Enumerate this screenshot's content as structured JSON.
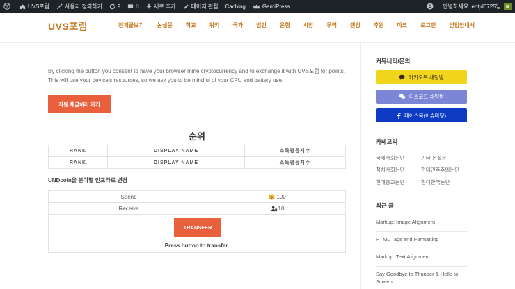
{
  "adminbar": {
    "site_name": "UVS포럼",
    "customize": "사용자 정의하기",
    "updates": "9",
    "comments": "0",
    "new": "새로 추가",
    "edit_page": "페이지 편집",
    "caching": "Caching",
    "gamipress": "GamiPress",
    "greeting": "안녕하세요. eotjd0725님"
  },
  "header": {
    "logo": "UVS포럼",
    "nav": [
      "전체글보기",
      "논설문",
      "학교",
      "위키",
      "국가",
      "법인",
      "은행",
      "시장",
      "무역",
      "랭킹",
      "후원",
      "마크",
      "로그인",
      "신입안내서"
    ]
  },
  "main": {
    "consent": "By clicking the button you consent to have your browser mine cryptocurrency and to exchange it with UVS포럼 for points. This will use your device's resources, so we ask you to be mindful of your CPU and battery use.",
    "mine_button": "자원 채굴하러 가기",
    "rank_title": "순위",
    "rank_headers": [
      [
        "RANK",
        "DISPLAY NAME",
        "소득평등지수"
      ],
      [
        "RANK",
        "DISPLAY NAME",
        "소득평등지수"
      ]
    ],
    "undcoin_title": "UNDcoin을 분야별 인프라로 변경",
    "spend_label": "Spend",
    "spend_value": "100",
    "receive_label": "Receive",
    "receive_value": "10",
    "transfer_button": "TRANSFER",
    "press_text": "Press button to transfer."
  },
  "sidebar": {
    "community_title": "커뮤니티/문의",
    "kakao": "카카오톡 채팅방",
    "discord": "디스코드 채팅방",
    "facebook": "페이스북(이슈마당)",
    "category_title": "카테고리",
    "categories": [
      "국제사회논단",
      "기타 논설문",
      "정치사회논단",
      "현대민주주의논단",
      "현대종교논단",
      "현대한국논단"
    ],
    "recent_title": "최근 글",
    "recent": [
      "Markup: Image Alignment",
      "HTML Tags and Formatting",
      "Markup: Text Alignment",
      "Say Goodbye to Thunder & Hello to Screenr"
    ]
  },
  "colors": {
    "accent": "#c5781e",
    "button": "#e9603d",
    "kakao": "#f1d41c",
    "discord": "#7b86d6",
    "facebook": "#0d3bc4"
  }
}
